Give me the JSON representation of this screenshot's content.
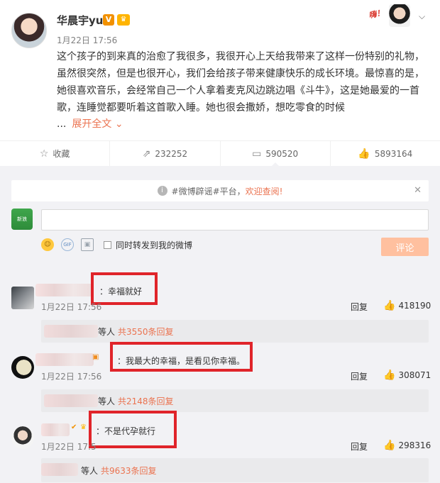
{
  "post": {
    "username": "华晨宇yu",
    "verified_badge": "V",
    "timestamp": "1月22日 17:56",
    "text": "这个孩子的到来真的治愈了我很多，我很开心上天给我带来了这样一份特别的礼物，虽然很突然，但是也很开心，我们会给孩子带来健康快乐的成长环境。最惊喜的是，她很喜欢音乐，会经常自己一个人拿着麦克风边跳边唱《斗牛》，这是她最爱的一首歌，连睡觉都要听着这首歌入睡。她也很会撒娇，想吃零食的时候",
    "ellipsis": "...",
    "expand_label": "展开全文",
    "top_logo_text": "嗨！",
    "actions": [
      {
        "icon": "star-icon",
        "label": "收藏"
      },
      {
        "icon": "share-icon",
        "label": "232252"
      },
      {
        "icon": "comment-icon",
        "label": "590520"
      },
      {
        "icon": "thumbs-up-icon",
        "label": "5893164"
      }
    ]
  },
  "comments_area": {
    "notice_prefix": "#微博辟谣#平台，",
    "notice_highlight": "欢迎查阅!",
    "my_avatar_text": "新浪",
    "input_placeholder": "",
    "sync_label": "同时转发到我的微博",
    "gif_label": "GIF",
    "submit_label": "评论"
  },
  "comments": [
    {
      "text": "：幸福就好",
      "time": "1月22日 17:56",
      "reply_label": "回复",
      "likes": "418190",
      "sub_suffix": "等人",
      "sub_count": "共3550条回复"
    },
    {
      "text": "：我最大的幸福，是看见你幸福。",
      "time": "1月22日 17:56",
      "reply_label": "回复",
      "likes": "308071",
      "sub_suffix": "等人",
      "sub_count": "共2148条回复"
    },
    {
      "text": "：不是代孕就行",
      "time": "1月22日 17:5",
      "reply_label": "回复",
      "likes": "298316",
      "sub_suffix": "等人",
      "sub_count": "共9633条回复"
    }
  ],
  "colors": {
    "accent": "#eb7350",
    "highlight_box": "#e0242a",
    "background_comments": "#f2f2f5"
  }
}
